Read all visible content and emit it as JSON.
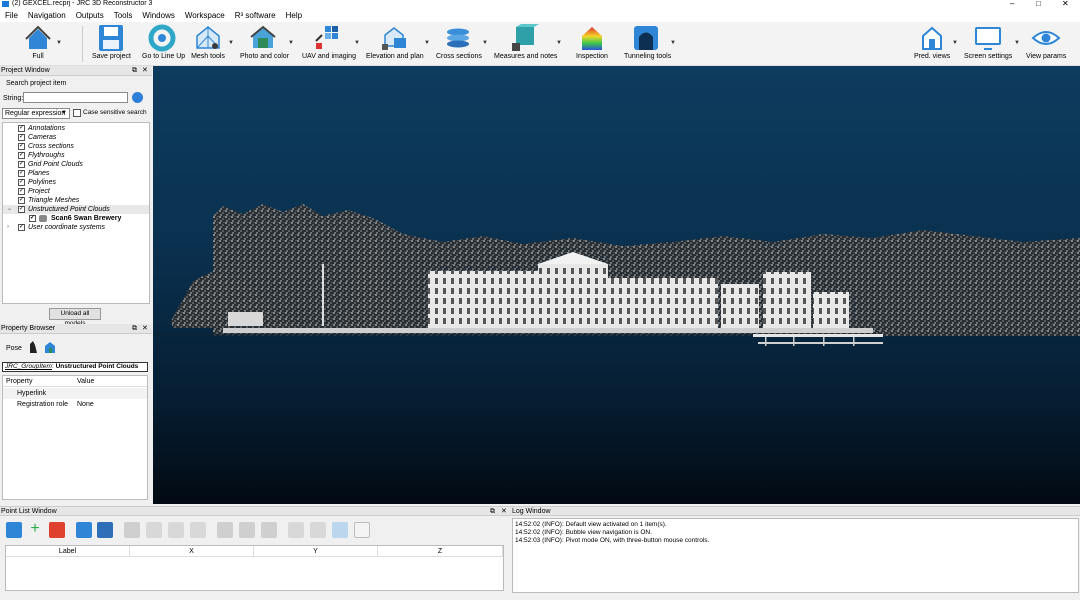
{
  "window": {
    "title": "(2) GEXCEL.recprj - JRC 3D Reconstructor 3",
    "minimize": "–",
    "maximize": "□",
    "close": "✕"
  },
  "menu": [
    "File",
    "Navigation",
    "Outputs",
    "Tools",
    "Windows",
    "Workspace",
    "R³ software",
    "Help"
  ],
  "toolbar": {
    "full": "Full",
    "save_project": "Save project",
    "go_to_line_up": "Go to Line Up",
    "mesh_tools": "Mesh tools",
    "photo_and_color": "Photo and color",
    "uav_and_imaging": "UAV and imaging",
    "elevation_and_plan": "Elevation and plan",
    "cross_sections": "Cross sections",
    "measures_and_notes": "Measures and notes",
    "inspection": "Inspection",
    "tunneling_tools": "Tunneling tools",
    "pred_views": "Pred. views",
    "screen_settings": "Screen settings",
    "view_params": "View params"
  },
  "project_window": {
    "title": "Project Window",
    "search_label": "Search project item",
    "string_label": "String:",
    "string_value": "",
    "regex_option": "Regular expression",
    "case_sensitive": "Case sensitive search",
    "case_sensitive_checked": false,
    "items": [
      {
        "label": "Annotations",
        "checked": true
      },
      {
        "label": "Cameras",
        "checked": true
      },
      {
        "label": "Cross sections",
        "checked": true
      },
      {
        "label": "Flythroughs",
        "checked": true
      },
      {
        "label": "Grid Point Clouds",
        "checked": true
      },
      {
        "label": "Planes",
        "checked": true
      },
      {
        "label": "Polylines",
        "checked": true
      },
      {
        "label": "Project",
        "checked": true
      },
      {
        "label": "Triangle Meshes",
        "checked": true
      },
      {
        "label": "Unstructured Point Clouds",
        "checked": true,
        "expanded": true
      },
      {
        "label": "Scan6 Swan Brewery",
        "checked": true,
        "child": true
      },
      {
        "label": "User coordinate systems",
        "checked": true,
        "collapsed": true
      }
    ],
    "unload_button": "Unload all models"
  },
  "property_browser": {
    "title": "Property Browser",
    "pose_label": "Pose",
    "group_type": "JRC_GroupItem",
    "group_name": "Unstructured Point Clouds",
    "header_property": "Property",
    "header_value": "Value",
    "rows": [
      {
        "key": "Hyperlink",
        "value": ""
      },
      {
        "key": "Registration role",
        "value": "None"
      }
    ]
  },
  "point_list": {
    "title": "Point List Window",
    "columns": [
      "Label",
      "X",
      "Y",
      "Z"
    ]
  },
  "log_window": {
    "title": "Log Window",
    "lines": [
      "14:52:02 (INFO): Default view activated on 1 item(s).",
      "14:52:02 (INFO): Bubble view navigation is ON.",
      "14:52:03 (INFO): Pivot mode ON, with three-button mouse controls."
    ]
  },
  "colors": {
    "accent_blue": "#1a7ad8",
    "viewport_top": "#0e3c5e",
    "viewport_bottom": "#020a13"
  }
}
